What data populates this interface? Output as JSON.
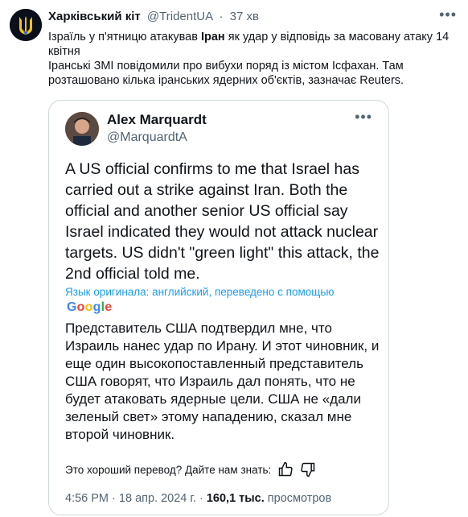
{
  "post": {
    "author_name": "Харківський кіт",
    "author_handle": "@TridentUA",
    "separator": "·",
    "time": "37 хв",
    "more_icon": "more-horizontal-icon",
    "text_part1": "Ізраїль у п'ятницю атакував ",
    "text_bold": "Іран",
    "text_part2": " як удар у відповідь за масовану атаку 14 квітня",
    "text_line2": "Іранські ЗМІ повідомили про вибухи поряд із містом Ісфахан.  Там розташовано кілька іранських ядерних об'єктів, зазначає Reuters."
  },
  "quote": {
    "author_name": "Alex Marquardt",
    "author_handle": "@MarquardtA",
    "more_icon": "more-horizontal-icon",
    "text": "A US official confirms to me that Israel has carried out a strike against Iran. Both the official and another senior US official say Israel indicated they would not attack nuclear targets. US didn't \"green light\" this attack, the 2nd official told me.",
    "translation_note": "Язык оригинала: английский, переведено с помощью",
    "translation_provider": "Google",
    "translated_text": "Представитель США подтвердил мне, что Израиль нанес удар по Ирану. И этот чиновник, и еще один высокопоставленный представитель США говорят, что Израиль дал понять, что не будет атаковать ядерные цели. США не «дали зеленый свет» этому нападению, сказал мне второй чиновник.",
    "feedback_prompt": "Это хороший перевод? Дайте нам знать:",
    "time": "4:56 PM",
    "date": "18 апр. 2024 г.",
    "views_count": "160,1 тыс.",
    "views_label": "просмотров",
    "dot": "·"
  },
  "colors": {
    "accent": "#1d9bf0",
    "secondary_text": "#536471",
    "border": "#cfd9de"
  }
}
